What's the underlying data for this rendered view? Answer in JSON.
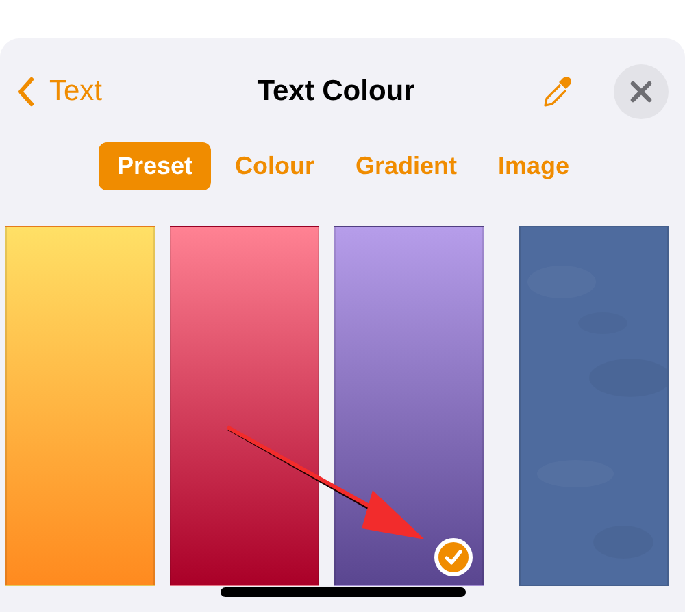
{
  "header": {
    "back_label": "Text",
    "title": "Text Colour"
  },
  "tabs": [
    {
      "label": "Preset",
      "selected": true
    },
    {
      "label": "Colour",
      "selected": false
    },
    {
      "label": "Gradient",
      "selected": false
    },
    {
      "label": "Image",
      "selected": false
    }
  ],
  "swatches": [
    {
      "kind": "gradient",
      "stops": [
        {
          "color": "#ffe066"
        },
        {
          "color": "#ff8a1f"
        }
      ],
      "selected": false
    },
    {
      "kind": "gradient",
      "stops": [
        {
          "color": "#ff8293"
        },
        {
          "color": "#aa0028"
        }
      ],
      "selected": false
    },
    {
      "kind": "gradient",
      "stops": [
        {
          "color": "#b69dea"
        },
        {
          "color": "#5a4690"
        }
      ],
      "selected": true
    },
    {
      "kind": "texture",
      "stops": [
        {
          "color": "#4e6b9e"
        }
      ],
      "selected": false
    }
  ]
}
